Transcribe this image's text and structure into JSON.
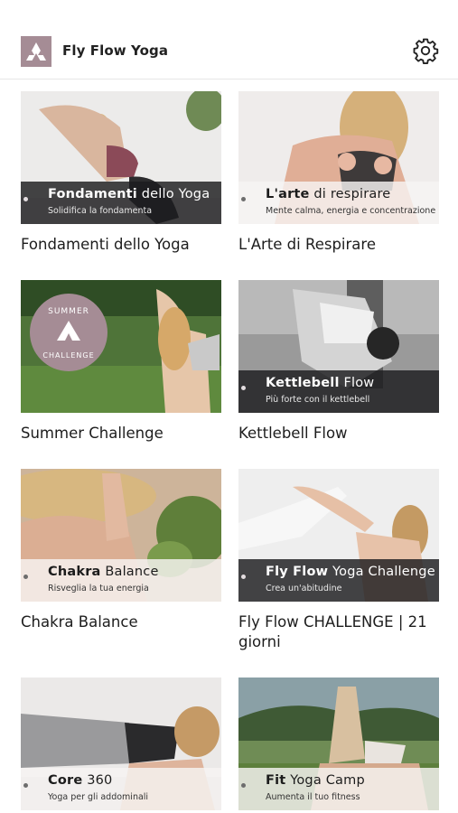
{
  "app": {
    "title": "Fly Flow Yoga"
  },
  "header": {
    "logo_icon": "triangle-logo-icon",
    "settings_icon": "gear-icon"
  },
  "colors": {
    "brand": "#a58c95",
    "band_dark": "#1c1c1e",
    "band_light": "#f6f4f3"
  },
  "programs": [
    {
      "title_bold": "Fondamenti",
      "title_rest": " dello Yoga",
      "subtitle": "Solidifica la fondamenta",
      "caption": "Fondamenti dello Yoga"
    },
    {
      "title_bold": "L'arte",
      "title_rest": " di respirare",
      "subtitle": "Mente calma, energia e concentrazione",
      "caption": "L'Arte di Respirare"
    },
    {
      "caption": "Summer Challenge",
      "badge_top": "SUMMER",
      "badge_bottom": "CHALLENGE"
    },
    {
      "title_bold": "Kettlebell",
      "title_rest": " Flow",
      "subtitle": "Più forte con il kettlebell",
      "caption": "Kettlebell Flow"
    },
    {
      "title_bold": "Chakra",
      "title_rest": " Balance",
      "subtitle": "Risveglia la tua energia",
      "caption": "Chakra Balance"
    },
    {
      "title_bold": "Fly Flow",
      "title_rest": " Yoga Challenge",
      "subtitle": "Crea un'abitudine",
      "caption": "Fly Flow CHALLENGE | 21 giorni"
    },
    {
      "title_bold": "Core",
      "title_rest": " 360",
      "subtitle": "Yoga per gli addominali",
      "caption": ""
    },
    {
      "title_bold": "Fit",
      "title_rest": " Yoga Camp",
      "subtitle": "Aumenta il tuo fitness",
      "caption": ""
    }
  ]
}
